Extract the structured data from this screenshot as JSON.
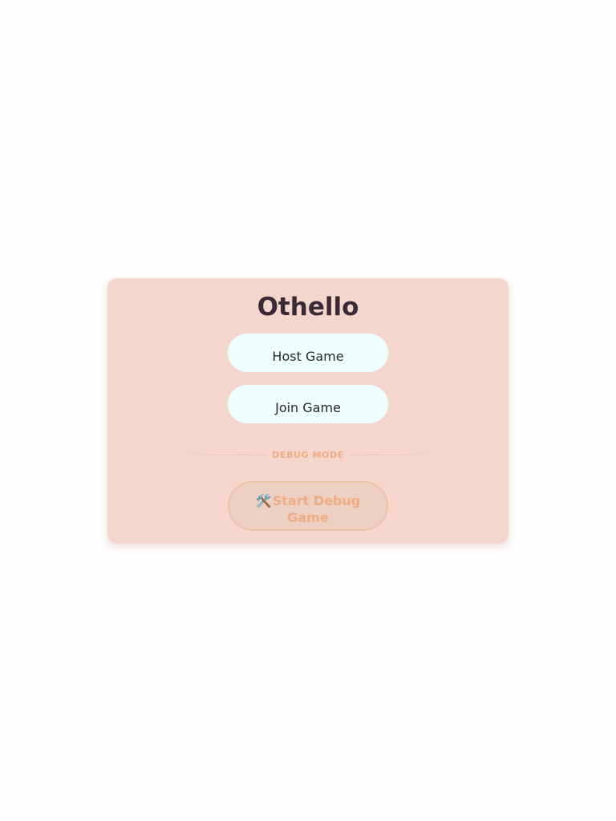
{
  "app": {
    "title": "Othello"
  },
  "menu": {
    "host_label": "Host Game",
    "join_label": "Join Game"
  },
  "debug": {
    "section_label": "DEBUG MODE",
    "button_icon": "🛠️",
    "button_icon_name": "hammer-and-wrench-icon",
    "button_label": "Start Debug Game"
  },
  "colors": {
    "page_background": "#fffdfd",
    "card_background": "#f4d6cd",
    "title_text": "#3a2a35",
    "menu_button_background": "#eefdfd",
    "debug_accent": "#f0ac84"
  }
}
